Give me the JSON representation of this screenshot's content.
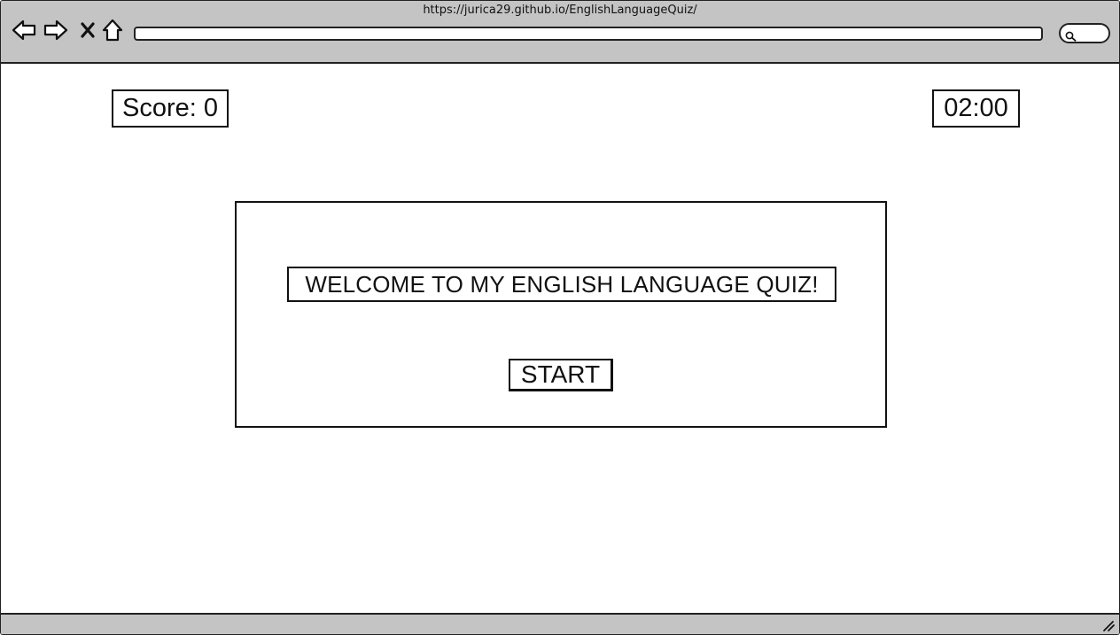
{
  "browser": {
    "url": "https://jurica29.github.io/EnglishLanguageQuiz/",
    "address_value": "",
    "icons": {
      "back": "back-arrow-icon",
      "forward": "forward-arrow-icon",
      "close": "close-icon",
      "home": "home-icon",
      "search": "search-icon",
      "resize": "resize-grip-icon"
    }
  },
  "quiz": {
    "score_label": "Score: 0",
    "timer": "02:00",
    "welcome_title": "WELCOME TO MY ENGLISH LANGUAGE QUIZ!",
    "start_label": "START"
  },
  "colors": {
    "chrome_background": "#c4c4c4",
    "page_background": "#ffffff",
    "stroke": "#111111"
  }
}
